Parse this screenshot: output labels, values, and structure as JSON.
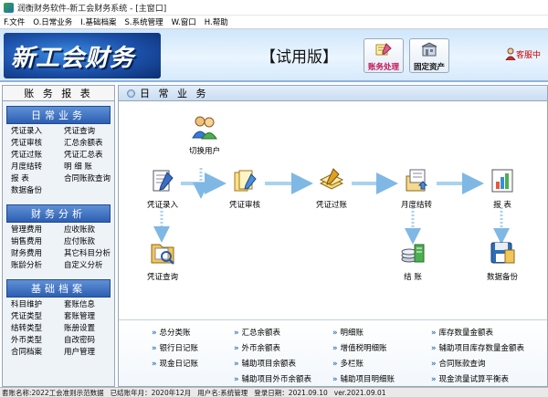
{
  "window": {
    "title": "润衡财务软件-新工会财务系统 - [主窗口]"
  },
  "menu": [
    "F.文件",
    "O.日常业务",
    "I.基础档案",
    "S.系统管理",
    "W.窗口",
    "H.帮助"
  ],
  "banner": {
    "logo": "新工会财务",
    "trial": "【试用版】",
    "btn_finance": "账务处理",
    "btn_assets": "固定资产",
    "service": "客服中"
  },
  "sidebar": {
    "title": "账 务 报 表",
    "sections": [
      {
        "title": "日常业务",
        "items": [
          "凭证录入",
          "凭证查询",
          "凭证审核",
          "汇总余额表",
          "凭证过账",
          "凭证汇总表",
          "月度结转",
          "明 细 账",
          "报 表",
          "合同账款查询",
          "数据备份"
        ]
      },
      {
        "title": "财务分析",
        "items": [
          "管理费用",
          "应收账款",
          "销售费用",
          "应付账款",
          "财务费用",
          "其它科目分析",
          "账龄分析",
          "自定义分析"
        ]
      },
      {
        "title": "基础档案",
        "items": [
          "科目维护",
          "套账信息",
          "凭证类型",
          "套账管理",
          "结转类型",
          "账册设置",
          "外币类型",
          "自改密码",
          "合同档案",
          "用户管理"
        ]
      }
    ]
  },
  "main": {
    "title": "日 常 业 务",
    "flow": {
      "switch_user": "切换用户",
      "voucher_entry": "凭证录入",
      "voucher_audit": "凭证审核",
      "voucher_post": "凭证过账",
      "month_close": "月度结转",
      "report": "报  表",
      "voucher_query": "凭证查询",
      "closing": "结  账",
      "data_backup": "数据备份"
    },
    "links": [
      "总分类账",
      "汇总余额表",
      "明细账",
      "库存数量金额表",
      "银行日记账",
      "外币余额表",
      "增值税明细账",
      "辅助项目库存数量金额表",
      "现金日记账",
      "辅助项目余额表",
      "多栏账",
      "合同账款查询",
      "辅助项目外币余额表",
      "辅助项目明细账",
      "现金流量试算平衡表"
    ]
  },
  "status": {
    "account": "套账名称:2022工会准则示范数据",
    "period": "已结账年月：2020年12月",
    "user": "用户名:系统管理",
    "login": "登录日期：2021.09.10",
    "version": "ver.2021.09.01"
  },
  "colors": {
    "accent": "#2d5fb2",
    "arrow": "#7fb8e4",
    "service_red": "#cc0000"
  }
}
